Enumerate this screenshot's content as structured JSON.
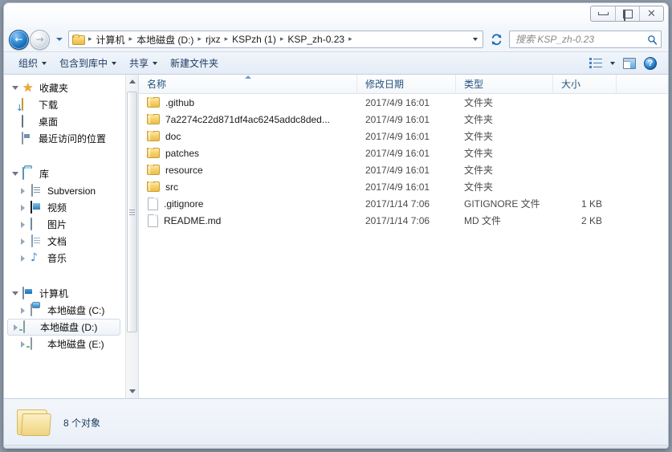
{
  "window": {
    "controls": {
      "minimize": "minimize",
      "maximize": "maximize",
      "close": "✕"
    }
  },
  "nav": {
    "back_glyph": "←",
    "forward_glyph": "→",
    "history_dropdown": "history-dropdown",
    "refresh_glyph": "↻"
  },
  "breadcrumb": {
    "separator": "▸",
    "items": [
      {
        "label": "计算机"
      },
      {
        "label": "本地磁盘 (D:)"
      },
      {
        "label": "rjxz"
      },
      {
        "label": "KSPzh (1)"
      },
      {
        "label": "KSP_zh-0.23"
      }
    ]
  },
  "search": {
    "placeholder": "搜索 KSP_zh-0.23",
    "value": ""
  },
  "toolbar": {
    "items": [
      {
        "label": "组织",
        "has_caret": true
      },
      {
        "label": "包含到库中",
        "has_caret": true
      },
      {
        "label": "共享",
        "has_caret": true
      },
      {
        "label": "新建文件夹",
        "has_caret": false
      }
    ],
    "view_button": "view-options",
    "preview_button": "preview-pane",
    "help_button": "?"
  },
  "sidebar": {
    "groups": [
      {
        "header": {
          "label": "收藏夹",
          "icon": "star-icon",
          "expanded": true
        },
        "items": [
          {
            "label": "下载",
            "icon": "folder-download-icon",
            "twisty": "none"
          },
          {
            "label": "桌面",
            "icon": "desktop-icon",
            "twisty": "none"
          },
          {
            "label": "最近访问的位置",
            "icon": "recent-places-icon",
            "twisty": "none"
          }
        ]
      },
      {
        "header": {
          "label": "库",
          "icon": "library-icon",
          "expanded": true
        },
        "items": [
          {
            "label": "Subversion",
            "icon": "subversion-icon",
            "twisty": "closed"
          },
          {
            "label": "视频",
            "icon": "video-icon",
            "twisty": "closed"
          },
          {
            "label": "图片",
            "icon": "pictures-icon",
            "twisty": "closed"
          },
          {
            "label": "文档",
            "icon": "documents-icon",
            "twisty": "closed"
          },
          {
            "label": "音乐",
            "icon": "music-icon",
            "twisty": "closed"
          }
        ]
      },
      {
        "header": {
          "label": "计算机",
          "icon": "computer-icon",
          "expanded": true
        },
        "items": [
          {
            "label": "本地磁盘 (C:)",
            "icon": "system-drive-icon",
            "twisty": "closed",
            "selected": false
          },
          {
            "label": "本地磁盘 (D:)",
            "icon": "drive-icon",
            "twisty": "closed",
            "selected": true
          },
          {
            "label": "本地磁盘 (E:)",
            "icon": "drive-icon",
            "twisty": "closed",
            "selected": false
          }
        ]
      }
    ]
  },
  "filelist": {
    "columns": [
      {
        "label": "名称",
        "sorted": true
      },
      {
        "label": "修改日期",
        "sorted": false
      },
      {
        "label": "类型",
        "sorted": false
      },
      {
        "label": "大小",
        "sorted": false
      }
    ],
    "rows": [
      {
        "name": ".github",
        "date": "2017/4/9 16:01",
        "type": "文件夹",
        "size": "",
        "kind": "folder"
      },
      {
        "name": "7a2274c22d871df4ac6245addc8ded...",
        "date": "2017/4/9 16:01",
        "type": "文件夹",
        "size": "",
        "kind": "folder"
      },
      {
        "name": "doc",
        "date": "2017/4/9 16:01",
        "type": "文件夹",
        "size": "",
        "kind": "folder"
      },
      {
        "name": "patches",
        "date": "2017/4/9 16:01",
        "type": "文件夹",
        "size": "",
        "kind": "folder"
      },
      {
        "name": "resource",
        "date": "2017/4/9 16:01",
        "type": "文件夹",
        "size": "",
        "kind": "folder"
      },
      {
        "name": "src",
        "date": "2017/4/9 16:01",
        "type": "文件夹",
        "size": "",
        "kind": "folder"
      },
      {
        "name": ".gitignore",
        "date": "2017/1/14 7:06",
        "type": "GITIGNORE 文件",
        "size": "1 KB",
        "kind": "file"
      },
      {
        "name": "README.md",
        "date": "2017/1/14 7:06",
        "type": "MD 文件",
        "size": "2 KB",
        "kind": "file"
      }
    ]
  },
  "status": {
    "text": "8 个对象"
  },
  "colors": {
    "accent_blue": "#24527f",
    "folder_yellow": "#f7d270",
    "chrome_blue": "#eaf0f8",
    "selection_blue": "#eaf4fd"
  }
}
